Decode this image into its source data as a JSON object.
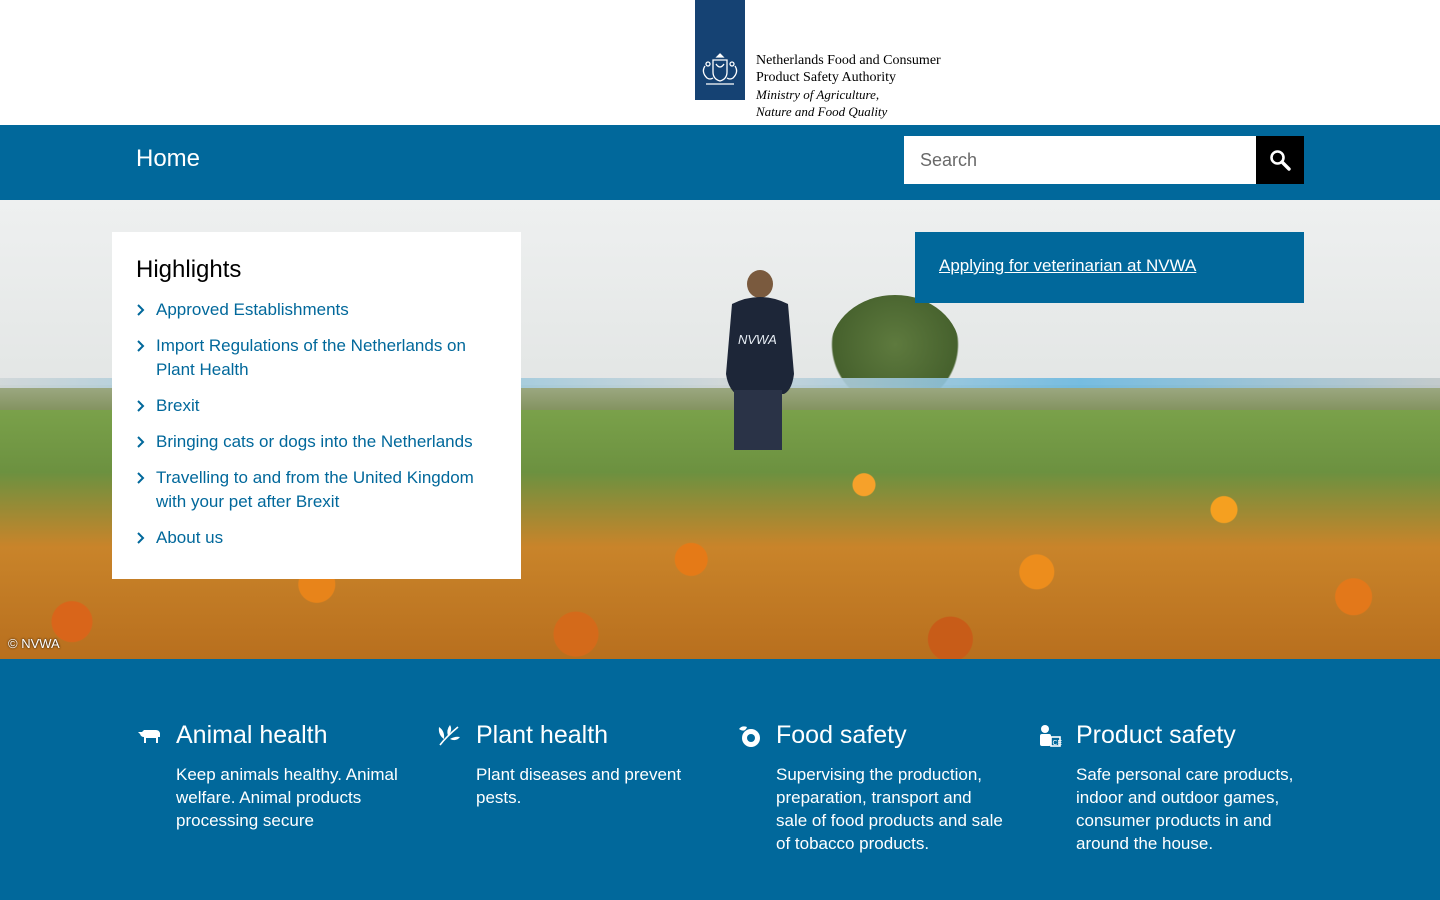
{
  "header": {
    "org_name_line1": "Netherlands Food and Consumer",
    "org_name_line2": "Product Safety Authority",
    "ministry_line1": "Ministry of Agriculture,",
    "ministry_line2": "Nature and Food Quality",
    "logo_icon": "coat-of-arms-icon"
  },
  "nav": {
    "home_label": "Home",
    "search_placeholder": "Search",
    "search_icon": "search-icon"
  },
  "highlights": {
    "title": "Highlights",
    "items": [
      {
        "label": "Approved Establishments"
      },
      {
        "label": "Import Regulations of the Netherlands on Plant Health"
      },
      {
        "label": "Brexit"
      },
      {
        "label": "Bringing cats or dogs into the Netherlands"
      },
      {
        "label": "Travelling to and from the United Kingdom with your pet after Brexit"
      },
      {
        "label": "About us"
      }
    ]
  },
  "promo": {
    "link_label": "Applying for veterinarian at NVWA"
  },
  "hero": {
    "jacket_text": "NVWA",
    "credit": "© NVWA"
  },
  "themes": [
    {
      "icon": "cow-icon",
      "title": "Animal health",
      "description": "Keep animals healthy. Animal welfare. Animal products processing secure"
    },
    {
      "icon": "plant-icon",
      "title": "Plant health",
      "description": "Plant diseases and prevent pests."
    },
    {
      "icon": "food-icon",
      "title": "Food safety",
      "description": "Supervising the production, preparation, transport and sale of food products and sale of tobacco products."
    },
    {
      "icon": "product-icon",
      "title": "Product safety",
      "description": "Safe personal care products, indoor and outdoor games, consumer products in and around the house."
    }
  ],
  "colors": {
    "brand_blue": "#01689b",
    "logo_blue": "#154273",
    "search_button": "#000000"
  }
}
